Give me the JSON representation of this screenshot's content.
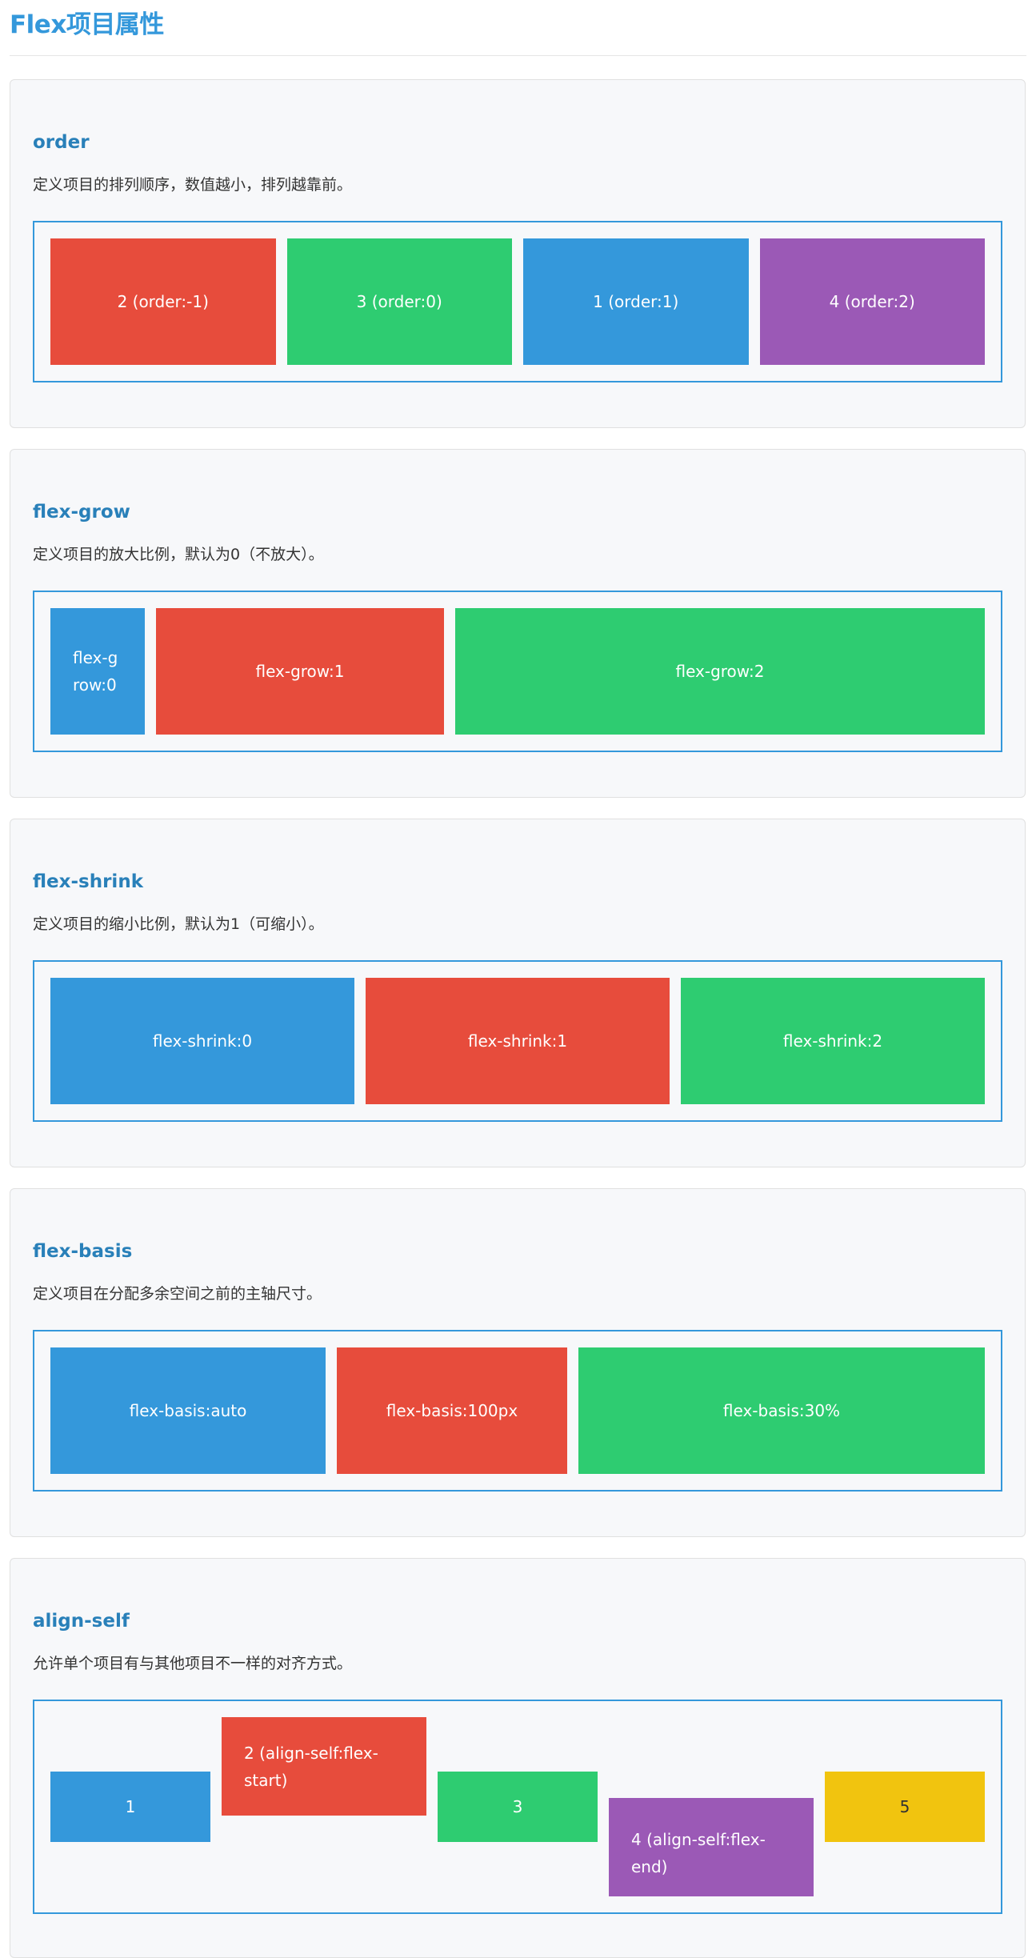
{
  "page": {
    "title": "Flex项目属性"
  },
  "sections": [
    {
      "title": "order",
      "desc": "定义项目的排列顺序，数值越小，排列越靠前。",
      "items": [
        "2 (order:-1)",
        "3 (order:0)",
        "1 (order:1)",
        "4 (order:2)"
      ]
    },
    {
      "title": "flex-grow",
      "desc": "定义项目的放大比例，默认为0（不放大）。",
      "items": [
        "flex-grow:0",
        "flex-grow:1",
        "flex-grow:2"
      ]
    },
    {
      "title": "flex-shrink",
      "desc": "定义项目的缩小比例，默认为1（可缩小）。",
      "items": [
        "flex-shrink:0",
        "flex-shrink:1",
        "flex-shrink:2"
      ]
    },
    {
      "title": "flex-basis",
      "desc": "定义项目在分配多余空间之前的主轴尺寸。",
      "items": [
        "flex-basis:auto",
        "flex-basis:100px",
        "flex-basis:30%"
      ]
    },
    {
      "title": "align-self",
      "desc": "允许单个项目有与其他项目不一样的对齐方式。",
      "items": [
        "1",
        "2 (align-self:flex-start)",
        "3",
        "4 (align-self:flex-end)",
        "5"
      ]
    }
  ],
  "colors": {
    "accent": "#3498db",
    "heading": "#2980b9",
    "red": "#e74c3c",
    "green": "#2ecc71",
    "blue": "#3498db",
    "purple": "#9b59b6",
    "yellow": "#f1c40f",
    "panel_bg": "#f7f8fa"
  }
}
